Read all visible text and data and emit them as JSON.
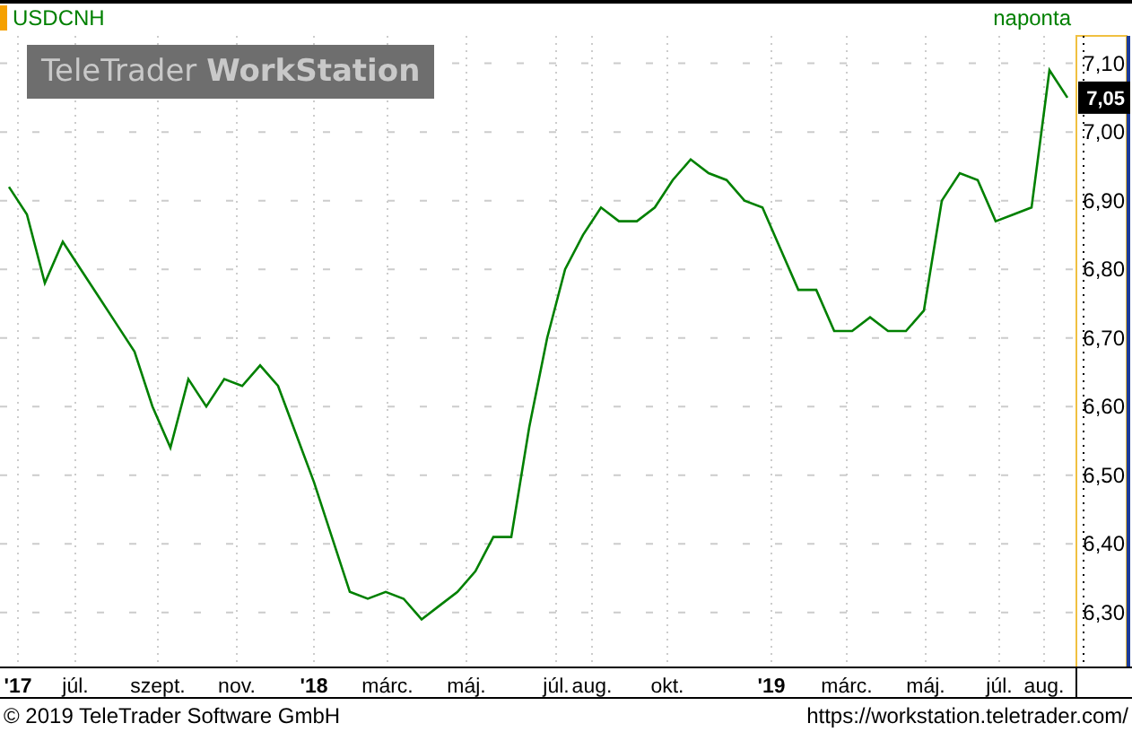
{
  "interval": "naponta",
  "logo": "TeleTrader **WorkStation**",
  "last_price": "7,05",
  "chart_data": {
    "type": "line",
    "series": [
      {
        "name": "USDCNH",
        "color": "#008000",
        "values": [
          6.92,
          6.88,
          6.78,
          6.84,
          6.8,
          6.76,
          6.72,
          6.68,
          6.6,
          6.54,
          6.64,
          6.6,
          6.64,
          6.63,
          6.66,
          6.63,
          6.56,
          6.49,
          6.41,
          6.33,
          6.32,
          6.33,
          6.32,
          6.29,
          6.31,
          6.33,
          6.36,
          6.41,
          6.41,
          6.57,
          6.7,
          6.8,
          6.85,
          6.89,
          6.87,
          6.87,
          6.89,
          6.93,
          6.96,
          6.94,
          6.93,
          6.9,
          6.89,
          6.83,
          6.77,
          6.77,
          6.71,
          6.71,
          6.73,
          6.71,
          6.71,
          6.74,
          6.9,
          6.94,
          6.93,
          6.87,
          6.88,
          6.89,
          7.09,
          7.05
        ]
      }
    ],
    "grid": true,
    "ylim": [
      6.22,
      7.14
    ],
    "yticks": [
      {
        "value": 6.3,
        "label": "6,30"
      },
      {
        "value": 6.4,
        "label": "6,40"
      },
      {
        "value": 6.5,
        "label": "6,50"
      },
      {
        "value": 6.6,
        "label": "6,60"
      },
      {
        "value": 6.7,
        "label": "6,70"
      },
      {
        "value": 6.8,
        "label": "6,80"
      },
      {
        "value": 6.9,
        "label": "6,90"
      },
      {
        "value": 7.0,
        "label": "7,00"
      },
      {
        "value": 7.1,
        "label": "7,10"
      }
    ]
  },
  "x_axis_labels": [
    {
      "label": "'17",
      "kind": "year"
    },
    {
      "label": "júl.",
      "kind": "month"
    },
    {
      "label": "szept.",
      "kind": "month"
    },
    {
      "label": "nov.",
      "kind": "month"
    },
    {
      "label": "'18",
      "kind": "year"
    },
    {
      "label": "márc.",
      "kind": "month"
    },
    {
      "label": "máj.",
      "kind": "month"
    },
    {
      "label": "júl.",
      "kind": "month"
    },
    {
      "label": "aug.",
      "kind": "month"
    },
    {
      "label": "okt.",
      "kind": "month"
    },
    {
      "label": "'19",
      "kind": "year"
    },
    {
      "label": "márc.",
      "kind": "month"
    },
    {
      "label": "máj.",
      "kind": "month"
    },
    {
      "label": "júl.",
      "kind": "month"
    },
    {
      "label": "aug.",
      "kind": "month"
    }
  ],
  "footer": {
    "copyright": "© 2019 TeleTrader Software GmbH",
    "url": "https://workstation.teletrader.com/"
  }
}
